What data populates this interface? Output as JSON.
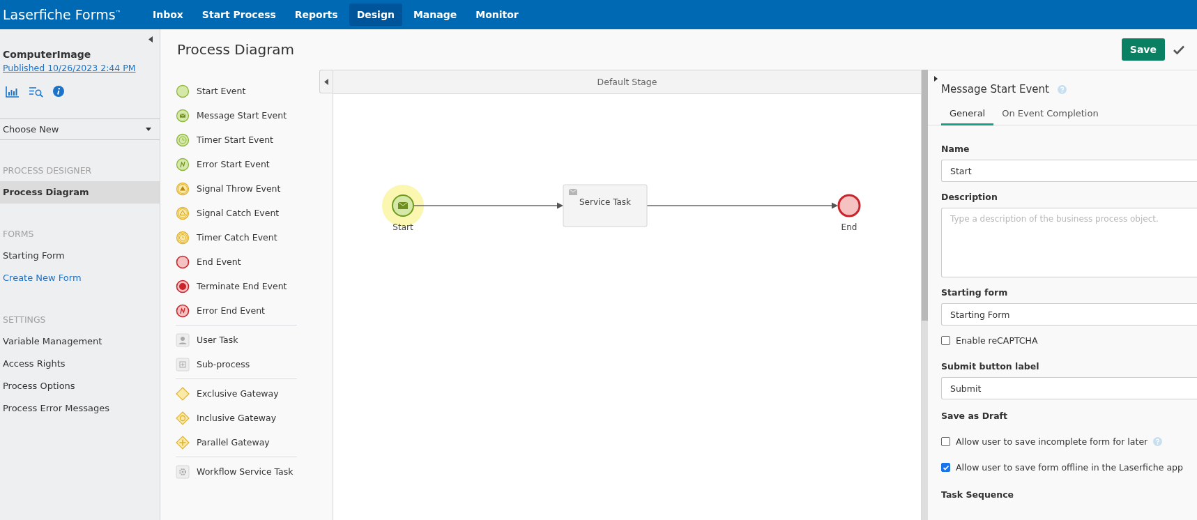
{
  "app": {
    "logo": "Laserfiche Forms",
    "trademark": "™"
  },
  "nav": [
    {
      "label": "Inbox",
      "selected": false
    },
    {
      "label": "Start Process",
      "selected": false
    },
    {
      "label": "Reports",
      "selected": false
    },
    {
      "label": "Design",
      "selected": true
    },
    {
      "label": "Manage",
      "selected": false
    },
    {
      "label": "Monitor",
      "selected": false
    }
  ],
  "sidebar": {
    "process_name": "ComputerImage",
    "published": "Published 10/26/2023 2:44 PM",
    "choose_new": "Choose New",
    "sections": [
      {
        "heading": "PROCESS DESIGNER",
        "items": [
          {
            "label": "Process Diagram",
            "selected": true,
            "kind": "nav"
          }
        ]
      },
      {
        "heading": "FORMS",
        "items": [
          {
            "label": "Starting Form",
            "selected": false,
            "kind": "nav"
          },
          {
            "label": "Create New Form",
            "selected": false,
            "kind": "link"
          }
        ]
      },
      {
        "heading": "SETTINGS",
        "items": [
          {
            "label": "Variable Management",
            "selected": false,
            "kind": "nav"
          },
          {
            "label": "Access Rights",
            "selected": false,
            "kind": "nav"
          },
          {
            "label": "Process Options",
            "selected": false,
            "kind": "nav"
          },
          {
            "label": "Process Error Messages",
            "selected": false,
            "kind": "nav"
          }
        ]
      }
    ]
  },
  "page_title": "Process Diagram",
  "palette": [
    [
      {
        "kind": "start",
        "label": "Start Event"
      },
      {
        "kind": "message_start",
        "label": "Message Start Event"
      },
      {
        "kind": "timer_start",
        "label": "Timer Start Event"
      },
      {
        "kind": "error_start",
        "label": "Error Start Event"
      },
      {
        "kind": "signal_throw",
        "label": "Signal Throw Event"
      },
      {
        "kind": "signal_catch",
        "label": "Signal Catch Event"
      },
      {
        "kind": "timer_catch",
        "label": "Timer Catch Event"
      },
      {
        "kind": "end",
        "label": "End Event"
      },
      {
        "kind": "terminate_end",
        "label": "Terminate End Event"
      },
      {
        "kind": "error_end",
        "label": "Error End Event"
      }
    ],
    [
      {
        "kind": "user_task",
        "label": "User Task"
      },
      {
        "kind": "subprocess",
        "label": "Sub-process"
      }
    ],
    [
      {
        "kind": "exclusive_gateway",
        "label": "Exclusive Gateway"
      },
      {
        "kind": "inclusive_gateway",
        "label": "Inclusive Gateway"
      },
      {
        "kind": "parallel_gateway",
        "label": "Parallel Gateway"
      }
    ],
    [
      {
        "kind": "workflow_service_task",
        "label": "Workflow Service Task"
      }
    ]
  ],
  "diagram": {
    "stage": "Default Stage",
    "nodes": [
      {
        "kind": "message_start",
        "label": "Start",
        "selected": true
      },
      {
        "kind": "service_task",
        "label": "Service Task",
        "selected": false
      },
      {
        "kind": "end",
        "label": "End",
        "selected": false
      }
    ]
  },
  "save": "Save",
  "properties": {
    "title": "Message Start Event",
    "tabs": [
      {
        "label": "General",
        "selected": true
      },
      {
        "label": "On Event Completion",
        "selected": false
      }
    ],
    "fields": [
      {
        "kind": "input",
        "label": "Name",
        "value": "Start"
      },
      {
        "kind": "textarea",
        "label": "Description",
        "placeholder": "Type a description of the business process object."
      },
      {
        "kind": "input",
        "label": "Starting form",
        "value": "Starting Form"
      },
      {
        "kind": "checkbox",
        "label": "Enable reCAPTCHA",
        "checked": false
      },
      {
        "kind": "input",
        "label": "Submit button label",
        "value": "Submit"
      },
      {
        "kind": "heading",
        "label": "Save as Draft"
      },
      {
        "kind": "checkbox",
        "label": "Allow user to save incomplete form for later",
        "checked": false,
        "help": true
      },
      {
        "kind": "checkbox",
        "label": "Allow user to save form offline in the Laserfiche app",
        "checked": true
      },
      {
        "kind": "heading",
        "label": "Task Sequence"
      }
    ]
  }
}
